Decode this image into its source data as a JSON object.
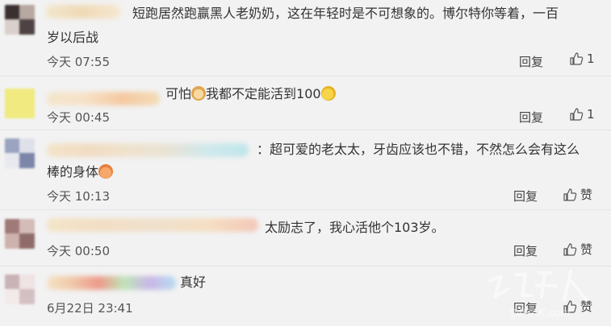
{
  "comments": [
    {
      "text_line1": "短跑居然跑赢黑人老奶奶，这在年轻时是不可想象的。博尔特你等着，一百",
      "text_line2": "岁以后战",
      "time": "今天 07:55",
      "reply": "回复",
      "like": "1"
    },
    {
      "prefix": "可怕",
      "text": "我都不定能活到100",
      "time": "今天 00:45",
      "reply": "回复",
      "like": "1"
    },
    {
      "prefix": "：",
      "text_line1": "超可爱的老太太，牙齿应该也不错，不然怎么会有这么",
      "text_line2": "棒的身体",
      "time": "今天 10:13",
      "reply": "回复",
      "like": "赞"
    },
    {
      "text": "太励志了，我心活他个103岁。",
      "time": "今天 00:50",
      "reply": "回复",
      "like": "赞"
    },
    {
      "text": "真好",
      "time": "6月22日 23:41",
      "reply": "回复",
      "like": "赞"
    }
  ],
  "icons": {
    "like": "thumbs-up-icon",
    "cat": "cat-face-emoji",
    "sweat": "sweat-smile-emoji",
    "hands": "folded-hands-emoji"
  },
  "watermark": {
    "logo": "环球人",
    "site": "94HAK.com"
  },
  "colors": {
    "background": "#f2f2f2",
    "divider": "#e4e4e4",
    "text": "#333333"
  }
}
